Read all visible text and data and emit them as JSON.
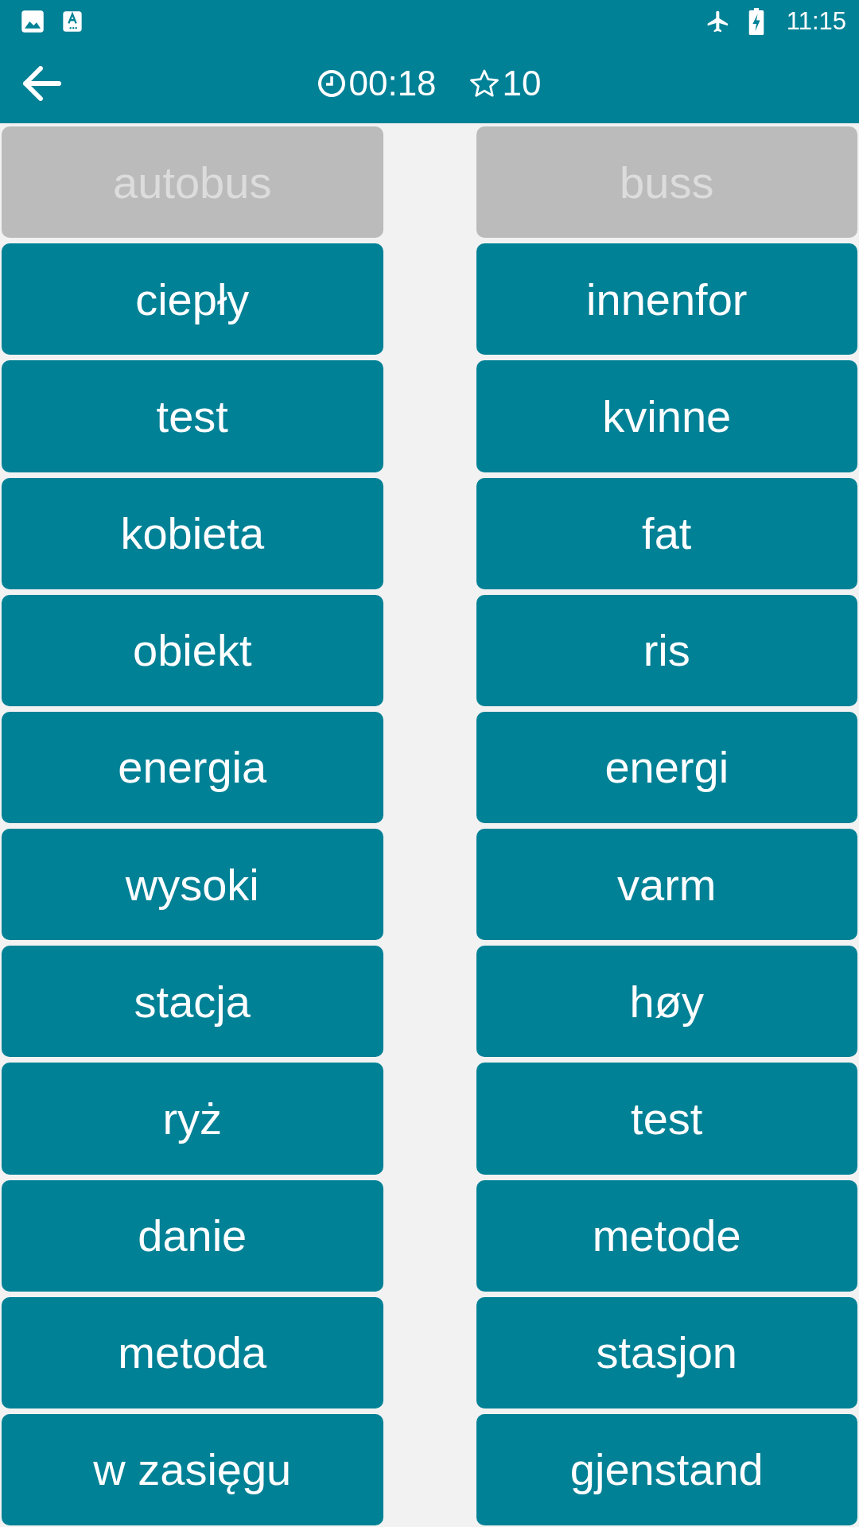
{
  "status_bar": {
    "time": "11:15"
  },
  "toolbar": {
    "timer": "00:18",
    "score": "10"
  },
  "columns": [
    {
      "tiles": [
        {
          "word": "autobus",
          "matched": true
        },
        {
          "word": "ciepły",
          "matched": false
        },
        {
          "word": "test",
          "matched": false
        },
        {
          "word": "kobieta",
          "matched": false
        },
        {
          "word": "obiekt",
          "matched": false
        },
        {
          "word": "energia",
          "matched": false
        },
        {
          "word": "wysoki",
          "matched": false
        },
        {
          "word": "stacja",
          "matched": false
        },
        {
          "word": "ryż",
          "matched": false
        },
        {
          "word": "danie",
          "matched": false
        },
        {
          "word": "metoda",
          "matched": false
        },
        {
          "word": "w zasięgu",
          "matched": false
        }
      ]
    },
    {
      "tiles": [
        {
          "word": "buss",
          "matched": true
        },
        {
          "word": "innenfor",
          "matched": false
        },
        {
          "word": "kvinne",
          "matched": false
        },
        {
          "word": "fat",
          "matched": false
        },
        {
          "word": "ris",
          "matched": false
        },
        {
          "word": "energi",
          "matched": false
        },
        {
          "word": "varm",
          "matched": false
        },
        {
          "word": "høy",
          "matched": false
        },
        {
          "word": "test",
          "matched": false
        },
        {
          "word": "metode",
          "matched": false
        },
        {
          "word": "stasjon",
          "matched": false
        },
        {
          "word": "gjenstand",
          "matched": false
        }
      ]
    }
  ]
}
